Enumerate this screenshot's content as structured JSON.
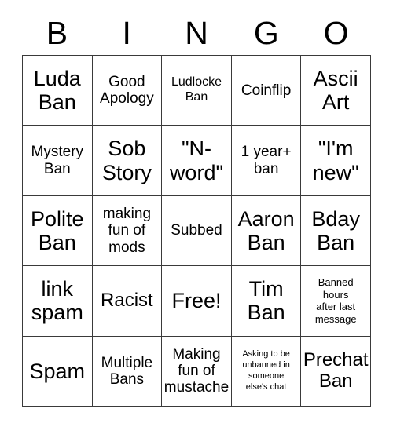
{
  "header": {
    "letters": [
      "B",
      "I",
      "N",
      "G",
      "O"
    ]
  },
  "grid": {
    "rows": 5,
    "columns": 5,
    "border_color": "#3a3a3a",
    "cell_background": "#ffffff",
    "text_color": "#000000",
    "cells": [
      {
        "text": "Luda\nBan",
        "size": "xl"
      },
      {
        "text": "Good\nApology",
        "size": "md"
      },
      {
        "text": "Ludlocke\nBan",
        "size": "sm"
      },
      {
        "text": "Coinflip",
        "size": "md"
      },
      {
        "text": "Ascii\nArt",
        "size": "xl"
      },
      {
        "text": "Mystery\nBan",
        "size": "md"
      },
      {
        "text": "Sob\nStory",
        "size": "xl"
      },
      {
        "text": "\"N-\nword\"",
        "size": "xl"
      },
      {
        "text": "1 year+\nban",
        "size": "md"
      },
      {
        "text": "\"I'm\nnew\"",
        "size": "xl"
      },
      {
        "text": "Polite\nBan",
        "size": "xl"
      },
      {
        "text": "making\nfun of\nmods",
        "size": "md"
      },
      {
        "text": "Subbed",
        "size": "md"
      },
      {
        "text": "Aaron\nBan",
        "size": "xl"
      },
      {
        "text": "Bday\nBan",
        "size": "xl"
      },
      {
        "text": "link\nspam",
        "size": "xl"
      },
      {
        "text": "Racist",
        "size": "lg"
      },
      {
        "text": "Free!",
        "size": "xl"
      },
      {
        "text": "Tim\nBan",
        "size": "xl"
      },
      {
        "text": "Banned\nhours\nafter last\nmessage",
        "size": "xs"
      },
      {
        "text": "Spam",
        "size": "xl"
      },
      {
        "text": "Multiple\nBans",
        "size": "md"
      },
      {
        "text": "Making\nfun of\nmustache",
        "size": "md"
      },
      {
        "text": "Asking to be\nunbanned in\nsomeone\nelse's chat",
        "size": "xxs"
      },
      {
        "text": "Prechat\nBan",
        "size": "lg"
      }
    ]
  }
}
